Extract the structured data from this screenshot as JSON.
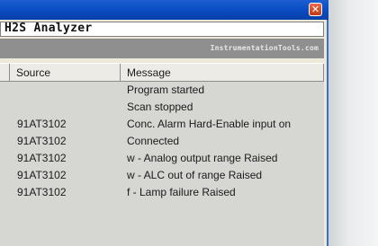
{
  "window": {
    "close_glyph": "✕",
    "title": "H2S Analyzer",
    "watermark": "InstrumentationTools.com"
  },
  "table": {
    "columns": [
      "Source",
      "Message"
    ],
    "rows": [
      {
        "source": "",
        "message": "Program started"
      },
      {
        "source": "",
        "message": "Scan stopped"
      },
      {
        "source": "91AT3102",
        "message": "Conc. Alarm Hard-Enable input on"
      },
      {
        "source": "91AT3102",
        "message": "Connected"
      },
      {
        "source": "91AT3102",
        "message": "w - Analog output range Raised"
      },
      {
        "source": "91AT3102",
        "message": "w - ALC out of range Raised"
      },
      {
        "source": "91AT3102",
        "message": "f - Lamp failure Raised"
      }
    ]
  }
}
